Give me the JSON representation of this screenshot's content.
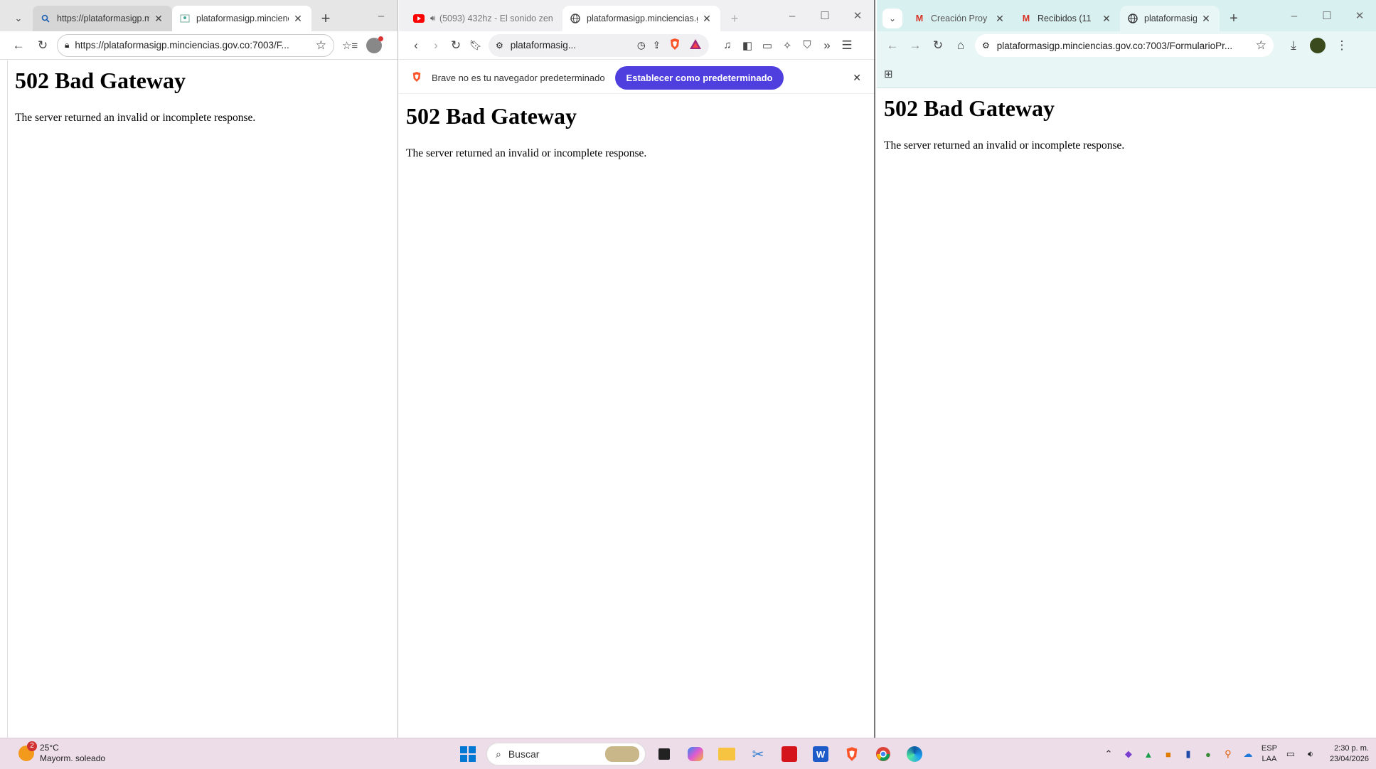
{
  "window1": {
    "tabs": [
      {
        "title": "https://plataformasigp.min",
        "close": "✕",
        "active": false
      },
      {
        "title": "plataformasigp.minciencia",
        "close": "✕",
        "active": true
      }
    ],
    "new_tab": "+",
    "url": "https://plataformasigp.minciencias.gov.co:7003/F...",
    "page": {
      "heading": "502 Bad Gateway",
      "message": "The server returned an invalid or incomplete response."
    }
  },
  "window2": {
    "tabs": [
      {
        "title": "(5093) 432hz - El sonido zen",
        "close": "✕",
        "active": false
      },
      {
        "title": "plataformasigp.minciencias.g",
        "close": "✕",
        "active": true
      }
    ],
    "new_tab": "+",
    "url": "plataformasig...",
    "infobar": {
      "message": "Brave no es tu navegador predeterminado",
      "button": "Establecer como predeterminado",
      "close": "✕"
    },
    "page": {
      "heading": "502 Bad Gateway",
      "message": "The server returned an invalid or incomplete response."
    }
  },
  "window3": {
    "tabs": [
      {
        "title": "Creación Proy",
        "close": "✕",
        "active": false
      },
      {
        "title": "Recibidos (11",
        "close": "✕",
        "active": false
      },
      {
        "title": "plataformasig",
        "close": "✕",
        "active": true
      }
    ],
    "new_tab": "+",
    "url": "plataformasigp.minciencias.gov.co:7003/FormularioPr...",
    "page": {
      "heading": "502 Bad Gateway",
      "message": "The server returned an invalid or incomplete response."
    }
  },
  "taskbar": {
    "weather": {
      "temp": "25°C",
      "condition": "Mayorm. soleado",
      "badge": "2"
    },
    "search_placeholder": "Buscar",
    "language": {
      "line1": "ESP",
      "line2": "LAA"
    },
    "clock": {
      "time": "2:30 p. m.",
      "date": "23/04/2026"
    }
  },
  "colors": {
    "brave_button": "#4f3fde",
    "taskbar": "#ecdde8",
    "chrome_tabbar": "#d9f0f0"
  }
}
